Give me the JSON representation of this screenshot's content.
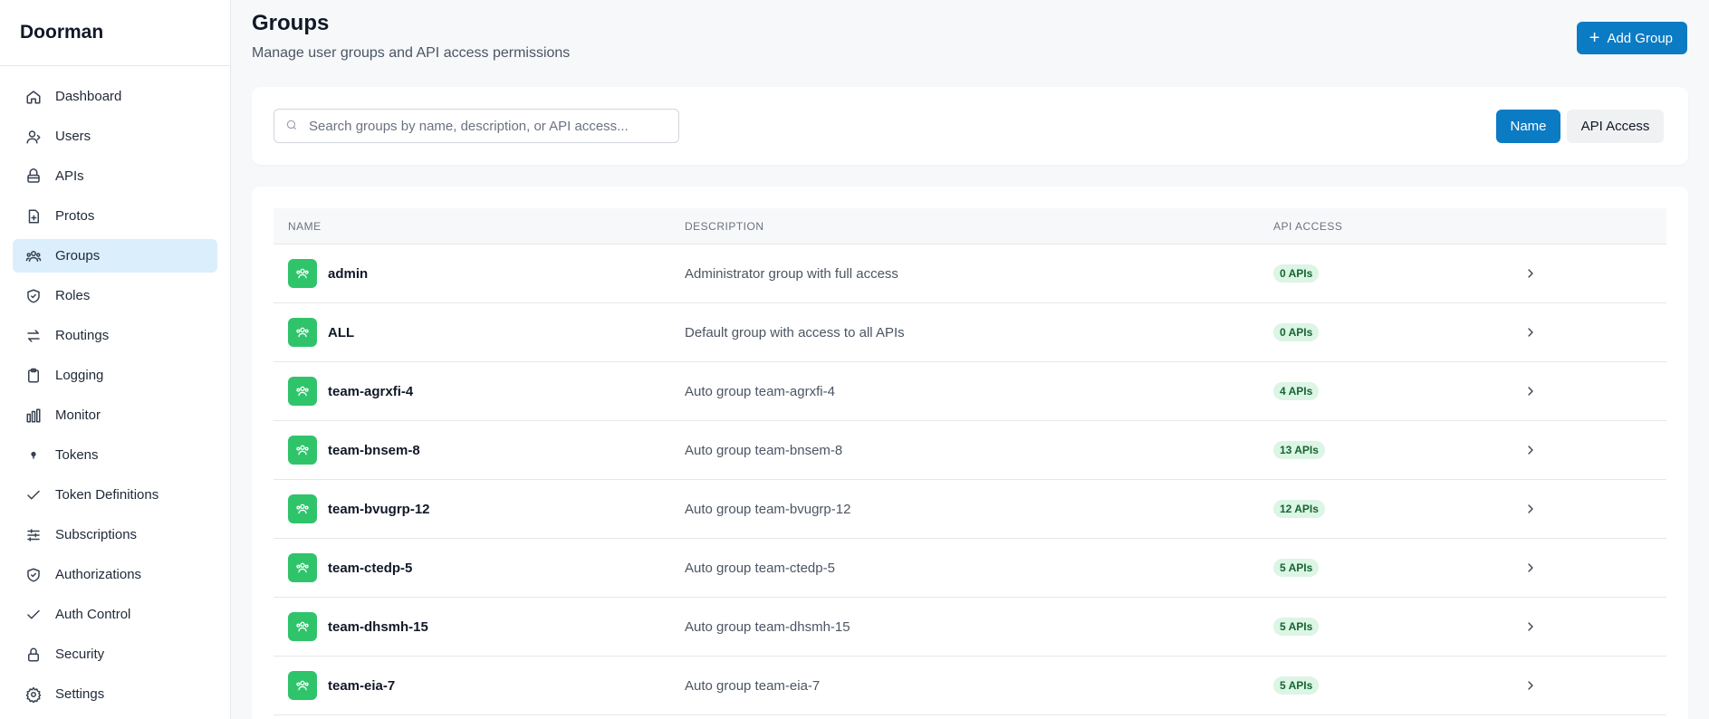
{
  "app": {
    "title": "Doorman"
  },
  "sidebar": {
    "items": [
      {
        "label": "Dashboard",
        "icon": "home-icon"
      },
      {
        "label": "Users",
        "icon": "users-icon"
      },
      {
        "label": "APIs",
        "icon": "layers-icon"
      },
      {
        "label": "Protos",
        "icon": "file-plus-icon"
      },
      {
        "label": "Groups",
        "icon": "group-icon",
        "active": true
      },
      {
        "label": "Roles",
        "icon": "shield-icon"
      },
      {
        "label": "Routings",
        "icon": "arrows-icon"
      },
      {
        "label": "Logging",
        "icon": "clipboard-icon"
      },
      {
        "label": "Monitor",
        "icon": "bar-chart-icon"
      },
      {
        "label": "Tokens",
        "icon": "dot-icon"
      },
      {
        "label": "Token Definitions",
        "icon": "check-icon"
      },
      {
        "label": "Subscriptions",
        "icon": "sliders-icon"
      },
      {
        "label": "Authorizations",
        "icon": "shield-check-icon"
      },
      {
        "label": "Auth Control",
        "icon": "check-icon"
      },
      {
        "label": "Security",
        "icon": "lock-icon"
      },
      {
        "label": "Settings",
        "icon": "gear-icon"
      }
    ]
  },
  "header": {
    "title": "Groups",
    "subtitle": "Manage user groups and API access permissions",
    "add_label": "Add Group"
  },
  "search": {
    "placeholder": "Search groups by name, description, or API access...",
    "filters": {
      "name_label": "Name",
      "api_label": "API Access",
      "active": "Name"
    }
  },
  "table": {
    "columns": {
      "name": "NAME",
      "description": "DESCRIPTION",
      "api_access": "API ACCESS"
    },
    "rows": [
      {
        "name": "admin",
        "description": "Administrator group with full access",
        "apis": "0 APIs"
      },
      {
        "name": "ALL",
        "description": "Default group with access to all APIs",
        "apis": "0 APIs"
      },
      {
        "name": "team-agrxfi-4",
        "description": "Auto group team-agrxfi-4",
        "apis": "4 APIs"
      },
      {
        "name": "team-bnsem-8",
        "description": "Auto group team-bnsem-8",
        "apis": "13 APIs"
      },
      {
        "name": "team-bvugrp-12",
        "description": "Auto group team-bvugrp-12",
        "apis": "12 APIs"
      },
      {
        "name": "team-ctedp-5",
        "description": "Auto group team-ctedp-5",
        "apis": "5 APIs"
      },
      {
        "name": "team-dhsmh-15",
        "description": "Auto group team-dhsmh-15",
        "apis": "5 APIs"
      },
      {
        "name": "team-eia-7",
        "description": "Auto group team-eia-7",
        "apis": "5 APIs"
      }
    ]
  },
  "colors": {
    "primary": "#0b7bc4",
    "active_nav_bg": "#dbeefc",
    "group_avatar": "#2fc46a",
    "badge_bg": "#dcf5e4",
    "badge_text": "#166534"
  }
}
